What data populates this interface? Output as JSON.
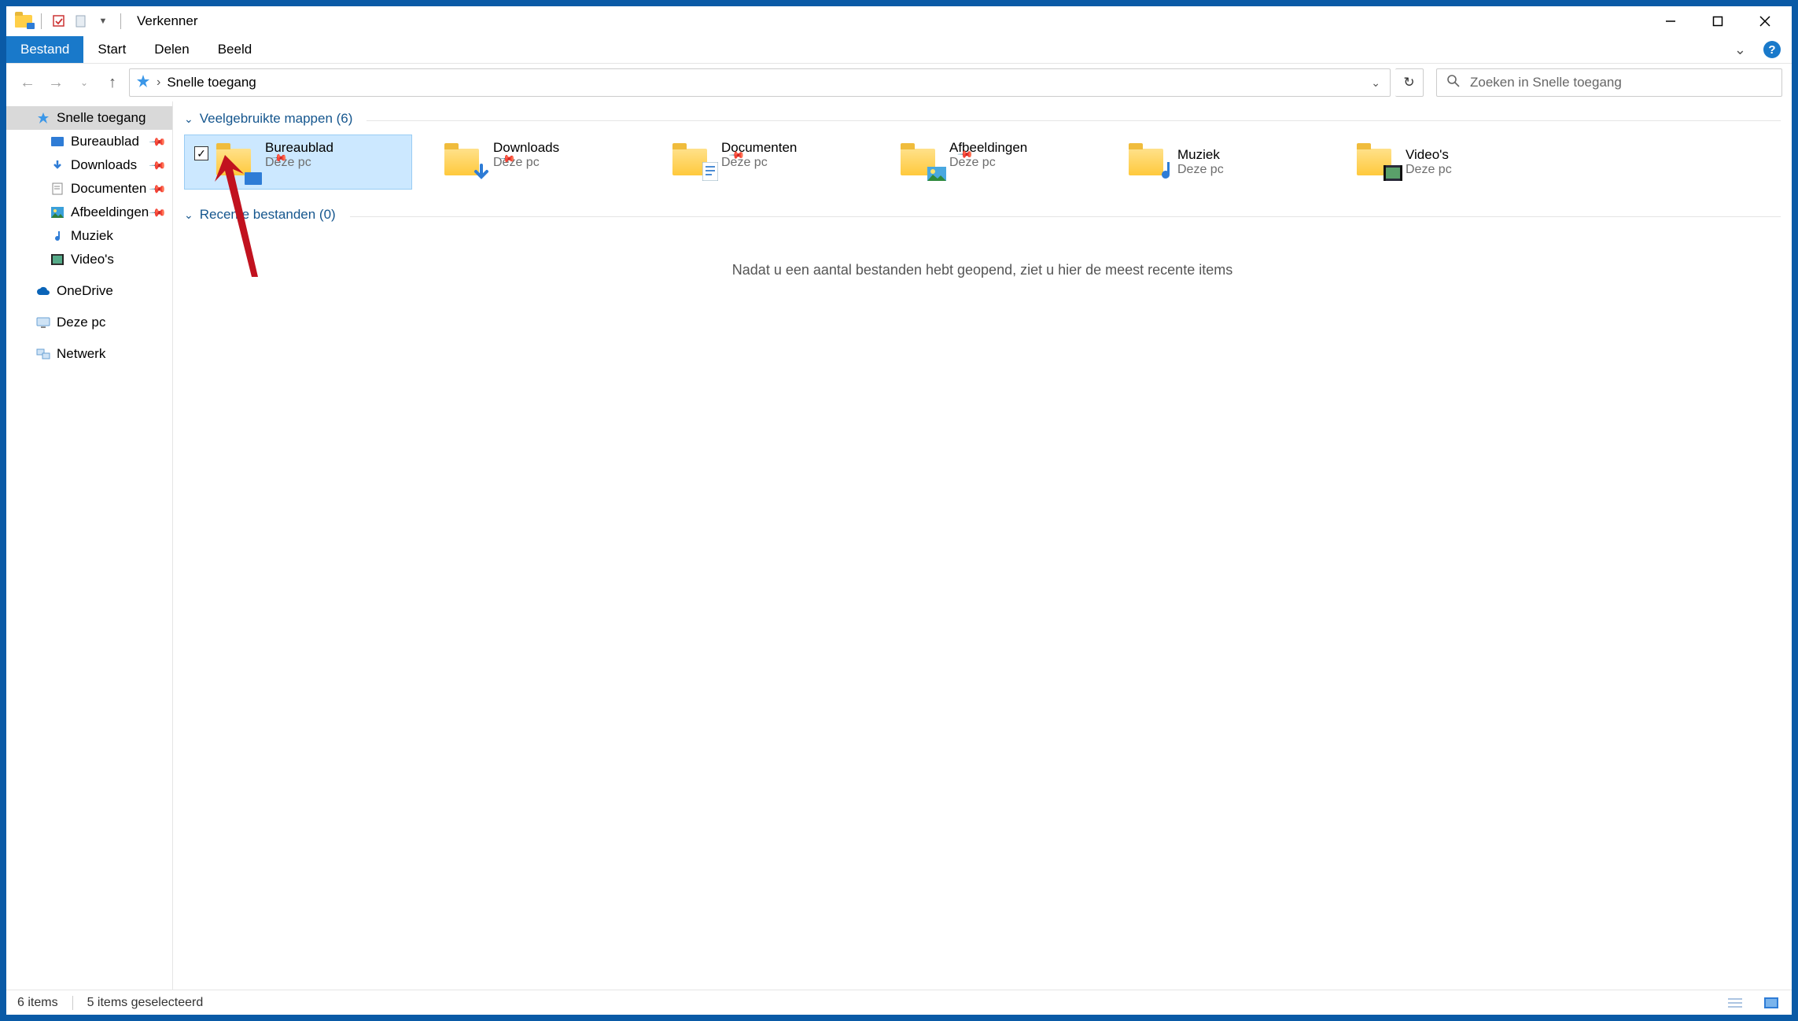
{
  "title": "Verkenner",
  "ribbon": {
    "file": "Bestand",
    "start": "Start",
    "share": "Delen",
    "view": "Beeld"
  },
  "breadcrumb": {
    "location": "Snelle toegang",
    "sep": "›"
  },
  "search": {
    "placeholder": "Zoeken in Snelle toegang"
  },
  "sidebar": {
    "quick": "Snelle toegang",
    "desktop": "Bureaublad",
    "downloads": "Downloads",
    "documents": "Documenten",
    "pictures": "Afbeeldingen",
    "music": "Muziek",
    "videos": "Video's",
    "onedrive": "OneDrive",
    "thispc": "Deze pc",
    "network": "Netwerk"
  },
  "sections": {
    "frequent": "Veelgebruikte mappen (6)",
    "recent": "Recente bestanden (0)"
  },
  "folders": {
    "sub": "Deze pc",
    "desktop": "Bureaublad",
    "downloads": "Downloads",
    "documents": "Documenten",
    "pictures": "Afbeeldingen",
    "music": "Muziek",
    "videos": "Video's"
  },
  "empty": "Nadat u een aantal bestanden hebt geopend, ziet u hier de meest recente items",
  "status": {
    "count": "6 items",
    "selected": "5 items geselecteerd"
  }
}
